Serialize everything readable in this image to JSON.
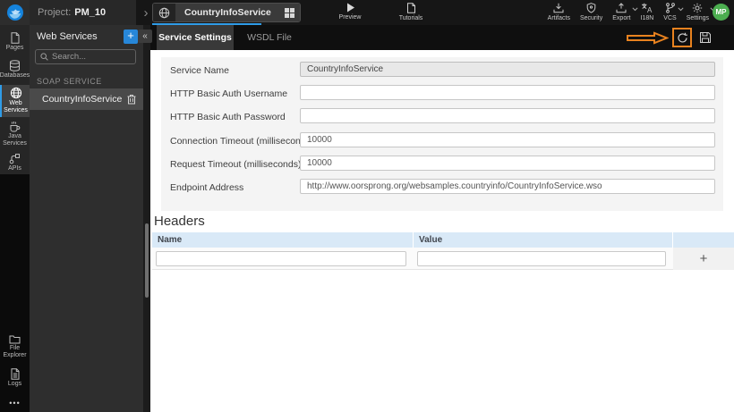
{
  "topbar": {
    "project_label": "Project:",
    "project_name": "PM_10",
    "doc_tab_title": "CountryInfoService",
    "preview_label": "Preview",
    "tutorials_label": "Tutorials",
    "actions": {
      "artifacts": "Artifacts",
      "security": "Security",
      "export": "Export",
      "i18n": "I18N",
      "vcs": "VCS",
      "settings": "Settings"
    },
    "avatar_initials": "MP"
  },
  "rail": {
    "items": [
      {
        "label": "Pages",
        "active": false
      },
      {
        "label": "Databases",
        "active": false
      },
      {
        "label": "Web Services",
        "active": true
      },
      {
        "label": "Java Services",
        "active": false
      },
      {
        "label": "APIs",
        "active": false
      }
    ],
    "bottom_items": [
      {
        "label": "File Explorer"
      },
      {
        "label": "Logs"
      }
    ]
  },
  "panel": {
    "title": "Web Services",
    "search_placeholder": "Search...",
    "section_label": "SOAP SERVICE",
    "service_name": "CountryInfoService"
  },
  "tabs": [
    {
      "label": "Service Settings",
      "active": true
    },
    {
      "label": "WSDL File",
      "active": false
    }
  ],
  "form": {
    "fields": [
      {
        "label": "Service Name",
        "value": "CountryInfoService",
        "disabled": true
      },
      {
        "label": "HTTP Basic Auth Username",
        "value": ""
      },
      {
        "label": "HTTP Basic Auth Password",
        "value": ""
      },
      {
        "label": "Connection Timeout (milliseconds)",
        "value": "10000"
      },
      {
        "label": "Request Timeout (milliseconds)",
        "value": "10000"
      },
      {
        "label": "Endpoint Address",
        "value": "http://www.oorsprong.org/websamples.countryinfo/CountryInfoService.wso"
      }
    ]
  },
  "headers_section": {
    "title": "Headers",
    "columns": {
      "name": "Name",
      "value": "Value"
    },
    "row": {
      "name_value": "",
      "value_value": ""
    },
    "add_label": "+"
  },
  "icons": {
    "collapse_glyph": "«",
    "breadcrumb_chevron": "›",
    "add_glyph": "+",
    "more_glyph": "•••"
  },
  "colors": {
    "accent_blue": "#2f9ce8",
    "annotation_orange": "#e8821f",
    "avatar_green": "#4cae50",
    "table_header_blue": "#d9e9f7"
  }
}
